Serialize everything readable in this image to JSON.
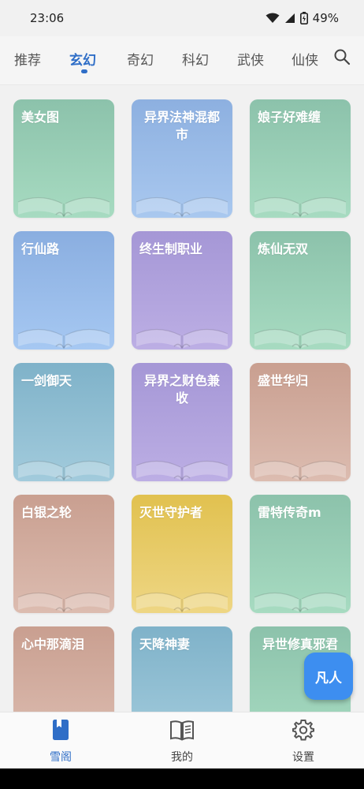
{
  "status_bar": {
    "time": "23:06",
    "battery": "49%"
  },
  "tabs": [
    {
      "label": "推荐",
      "active": false
    },
    {
      "label": "玄幻",
      "active": true
    },
    {
      "label": "奇幻",
      "active": false
    },
    {
      "label": "科幻",
      "active": false
    },
    {
      "label": "武侠",
      "active": false
    },
    {
      "label": "仙侠",
      "active": false
    }
  ],
  "books": [
    {
      "title": "美女图",
      "color_top": "#8cc2ab",
      "color_bottom": "#a7dbc1",
      "center": false
    },
    {
      "title": "异界法神混都市",
      "color_top": "#8db0e0",
      "color_bottom": "#a9c8ef",
      "center": true
    },
    {
      "title": "娘子好难缠",
      "color_top": "#8cc2ab",
      "color_bottom": "#a7dbc1",
      "center": false
    },
    {
      "title": "行仙路",
      "color_top": "#8aaee0",
      "color_bottom": "#a6c8f2",
      "center": false
    },
    {
      "title": "终生制职业",
      "color_top": "#a597d6",
      "color_bottom": "#bcaee4",
      "center": false
    },
    {
      "title": "炼仙无双",
      "color_top": "#8cc2ab",
      "color_bottom": "#a7dbc1",
      "center": false
    },
    {
      "title": "一剑御天",
      "color_top": "#7fb2c9",
      "color_bottom": "#a2cbdc",
      "center": false
    },
    {
      "title": "异界之财色兼收",
      "color_top": "#a597d6",
      "color_bottom": "#bcaee4",
      "center": true
    },
    {
      "title": "盛世华归",
      "color_top": "#c99f90",
      "color_bottom": "#dcbcb0",
      "center": false
    },
    {
      "title": "白银之轮",
      "color_top": "#c99f90",
      "color_bottom": "#dcbcb0",
      "center": false
    },
    {
      "title": "灭世守护者",
      "color_top": "#e1c14f",
      "color_bottom": "#eed684",
      "center": false
    },
    {
      "title": "雷特传奇m",
      "color_top": "#8cc2ab",
      "color_bottom": "#a7dbc1",
      "center": false
    },
    {
      "title": "心中那滴泪",
      "color_top": "#c99f90",
      "color_bottom": "#dcbcb0",
      "center": false
    },
    {
      "title": "天降神妻",
      "color_top": "#7fb2c9",
      "color_bottom": "#a2cbdc",
      "center": false
    },
    {
      "title": "异世修真邪君",
      "color_top": "#8cc2ab",
      "color_bottom": "#a7dbc1",
      "center": true
    }
  ],
  "fab": {
    "label": "凡人"
  },
  "bottom_nav": [
    {
      "label": "雪阁",
      "icon": "book-icon",
      "active": true
    },
    {
      "label": "我的",
      "icon": "open-book-icon",
      "active": false
    },
    {
      "label": "设置",
      "icon": "gear-icon",
      "active": false
    }
  ],
  "colors": {
    "accent": "#2f6ec7",
    "fab": "#3d8ef0"
  }
}
